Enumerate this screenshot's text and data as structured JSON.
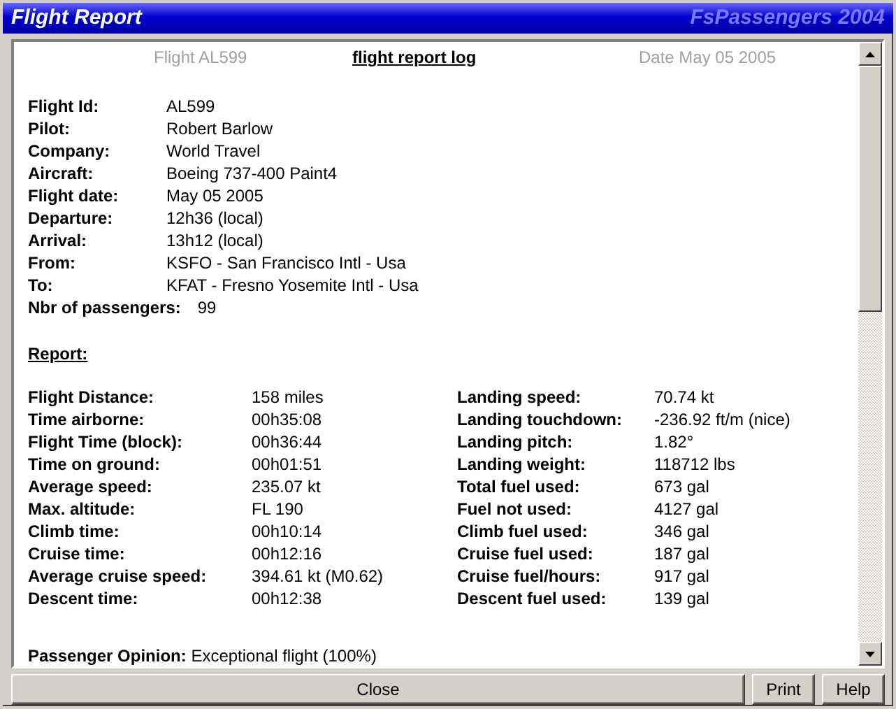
{
  "window": {
    "title": "Flight Report",
    "brand": "FsPassengers 2004"
  },
  "header": {
    "flight": "Flight AL599",
    "heading": "flight report log",
    "date": "Date May 05 2005"
  },
  "details": [
    {
      "label": "Flight Id:",
      "value": "AL599"
    },
    {
      "label": "Pilot:",
      "value": "Robert Barlow"
    },
    {
      "label": "Company:",
      "value": "World Travel"
    },
    {
      "label": "Aircraft:",
      "value": "Boeing 737-400 Paint4"
    },
    {
      "label": "Flight date:",
      "value": "May 05 2005"
    },
    {
      "label": "Departure:",
      "value": "12h36 (local)"
    },
    {
      "label": "Arrival:",
      "value": "13h12 (local)"
    },
    {
      "label": "From:",
      "value": "KSFO - San Francisco Intl - Usa"
    },
    {
      "label": "To:",
      "value": "KFAT - Fresno Yosemite Intl - Usa"
    },
    {
      "label": "Nbr of passengers:",
      "value": "99"
    }
  ],
  "report_heading": "Report:",
  "stats_left": [
    {
      "label": "Flight Distance:",
      "value": "158 miles"
    },
    {
      "label": "Time airborne:",
      "value": "00h35:08"
    },
    {
      "label": "Flight Time (block):",
      "value": "00h36:44"
    },
    {
      "label": "Time on ground:",
      "value": "00h01:51"
    },
    {
      "label": "Average speed:",
      "value": "235.07 kt"
    },
    {
      "label": "Max. altitude:",
      "value": "FL 190"
    },
    {
      "label": "Climb time:",
      "value": "00h10:14"
    },
    {
      "label": "Cruise time:",
      "value": "00h12:16"
    },
    {
      "label": "Average cruise speed:",
      "value": "394.61 kt (M0.62)"
    },
    {
      "label": "Descent time:",
      "value": "00h12:38"
    }
  ],
  "stats_right": [
    {
      "label": "Landing speed:",
      "value": "70.74 kt"
    },
    {
      "label": "Landing touchdown:",
      "value": "-236.92 ft/m (nice)"
    },
    {
      "label": "Landing pitch:",
      "value": "1.82°"
    },
    {
      "label": "Landing weight:",
      "value": "118712 lbs"
    },
    {
      "label": "Total fuel used:",
      "value": "673 gal"
    },
    {
      "label": "Fuel not used:",
      "value": "4127 gal"
    },
    {
      "label": "Climb fuel used:",
      "value": "346 gal"
    },
    {
      "label": "Cruise fuel used:",
      "value": "187 gal"
    },
    {
      "label": "Cruise fuel/hours:",
      "value": "917 gal"
    },
    {
      "label": "Descent fuel used:",
      "value": "139 gal"
    }
  ],
  "opinion": {
    "label": "Passenger Opinion:",
    "value": "Exceptional flight (100%)"
  },
  "buttons": [
    {
      "label": "Close",
      "kind": "wide"
    },
    {
      "label": "Print",
      "kind": "small"
    },
    {
      "label": "Help",
      "kind": "small"
    }
  ]
}
